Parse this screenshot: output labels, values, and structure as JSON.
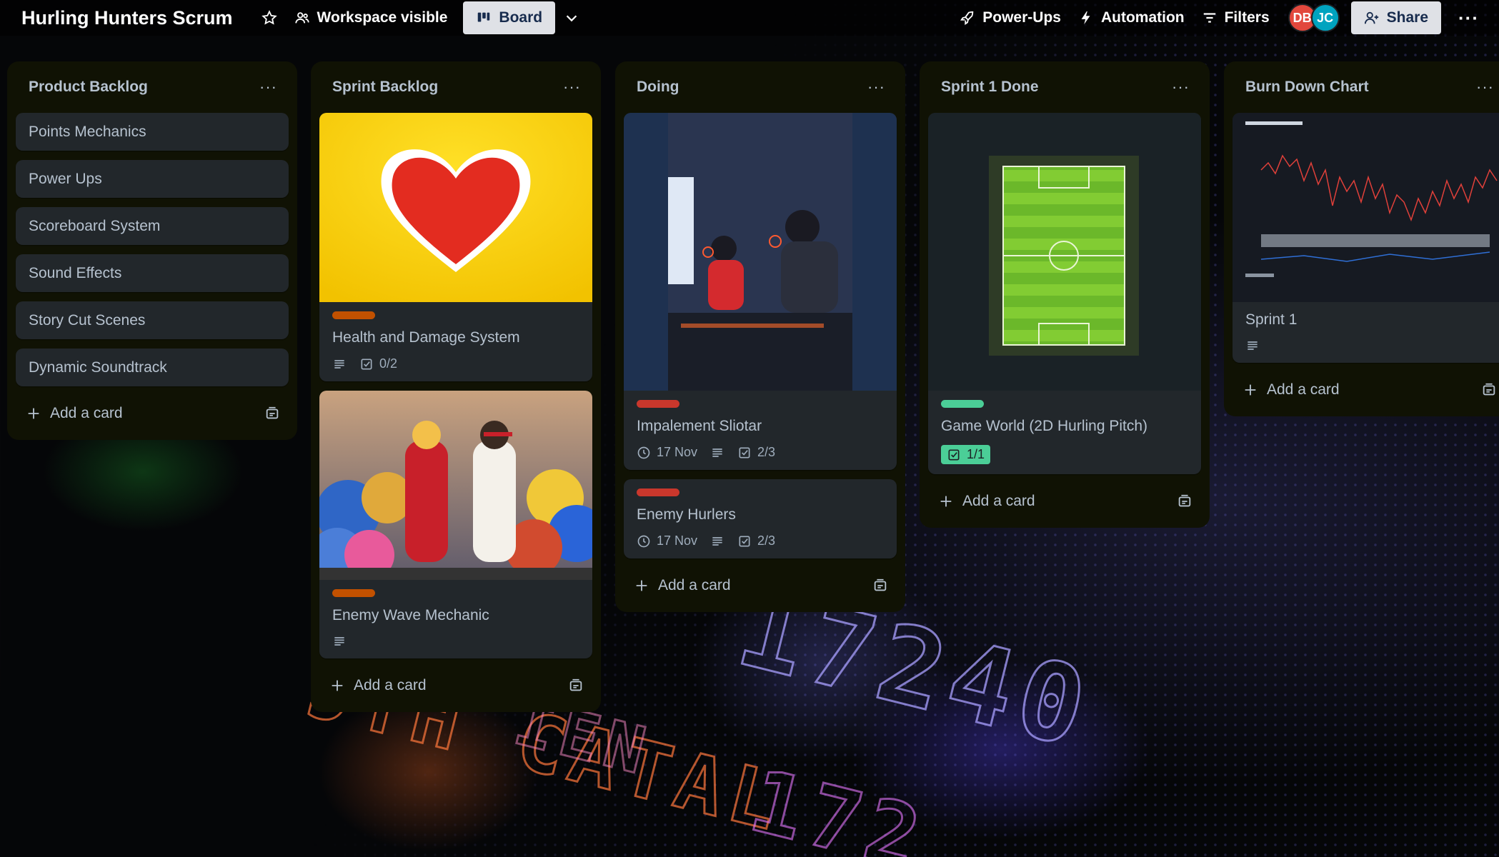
{
  "header": {
    "board_title": "Hurling Hunters Scrum",
    "visibility_label": "Workspace visible",
    "view_label": "Board",
    "powerups_label": "Power-Ups",
    "automation_label": "Automation",
    "filters_label": "Filters",
    "members": [
      {
        "initials": "DB",
        "color": "#e2483d"
      },
      {
        "initials": "JC",
        "color": "#00a3bf"
      }
    ],
    "share_label": "Share"
  },
  "lists": [
    {
      "title": "Product Backlog",
      "cards": [
        {
          "title": "Points Mechanics"
        },
        {
          "title": "Power Ups"
        },
        {
          "title": "Scoreboard System"
        },
        {
          "title": "Sound Effects"
        },
        {
          "title": "Story Cut Scenes"
        },
        {
          "title": "Dynamic Soundtrack"
        }
      ],
      "add_card_label": "Add a card"
    },
    {
      "title": "Sprint Backlog",
      "cards": [
        {
          "title": "Health and Damage System",
          "label_color": "#c25100",
          "cover": "yellow heart",
          "checklist": "0/2",
          "has_description": true
        },
        {
          "title": "Enemy Wave Mechanic",
          "label_color": "#c25100",
          "cover": "fighter figures",
          "has_description": true
        }
      ],
      "add_card_label": "Add a card"
    },
    {
      "title": "Doing",
      "cards": [
        {
          "title": "Impalement Sliotar",
          "label_color": "#c9372c",
          "cover": "gamers",
          "due": "17 Nov",
          "checklist": "2/3",
          "has_description": true
        },
        {
          "title": "Enemy Hurlers",
          "label_color": "#c9372c",
          "due": "17 Nov",
          "checklist": "2/3",
          "has_description": true
        }
      ],
      "add_card_label": "Add a card"
    },
    {
      "title": "Sprint 1 Done",
      "cards": [
        {
          "title": "Game World (2D Hurling Pitch)",
          "label_color": "#4bce97",
          "cover": "pitch",
          "checklist": "1/1"
        }
      ],
      "add_card_label": "Add a card"
    },
    {
      "title": "Burn Down Chart",
      "cards": [
        {
          "title": "Sprint 1",
          "cover": "chart",
          "has_description": true
        }
      ],
      "add_card_label": "Add a card"
    }
  ]
}
